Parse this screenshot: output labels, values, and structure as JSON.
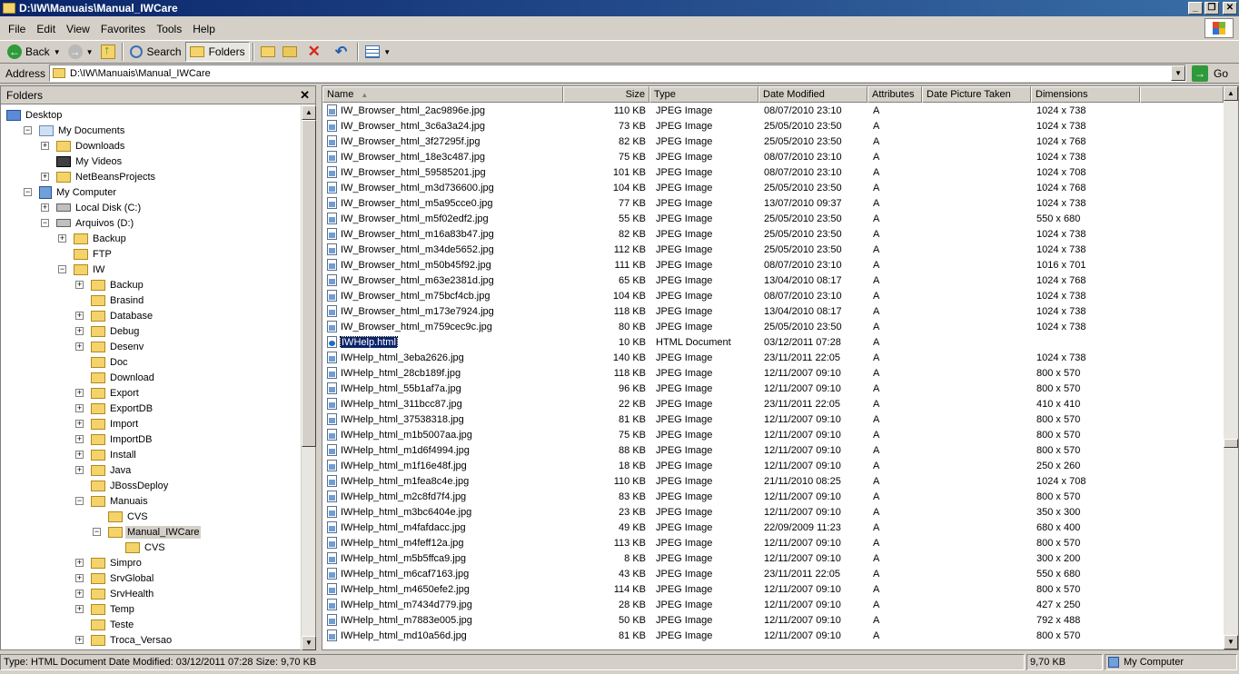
{
  "window": {
    "title": "D:\\IW\\Manuais\\Manual_IWCare",
    "min": "_",
    "restore": "❐",
    "close": "✕"
  },
  "menu": [
    {
      "label": "File"
    },
    {
      "label": "Edit"
    },
    {
      "label": "View"
    },
    {
      "label": "Favorites"
    },
    {
      "label": "Tools"
    },
    {
      "label": "Help"
    }
  ],
  "toolbar": {
    "back_label": "Back",
    "search_label": "Search",
    "folders_label": "Folders"
  },
  "address": {
    "label": "Address",
    "value": "D:\\IW\\Manuais\\Manual_IWCare",
    "go_label": "Go"
  },
  "folders": {
    "title": "Folders",
    "close": "✕",
    "tree": [
      {
        "label": "Desktop",
        "depth": 0,
        "exp": "",
        "icon": "desk"
      },
      {
        "label": "My Documents",
        "depth": 1,
        "exp": "−",
        "icon": "docs"
      },
      {
        "label": "Downloads",
        "depth": 2,
        "exp": "+",
        "icon": "folder"
      },
      {
        "label": "My Videos",
        "depth": 2,
        "exp": "",
        "icon": "vid"
      },
      {
        "label": "NetBeansProjects",
        "depth": 2,
        "exp": "+",
        "icon": "folder"
      },
      {
        "label": "My Computer",
        "depth": 1,
        "exp": "−",
        "icon": "comp"
      },
      {
        "label": "Local Disk (C:)",
        "depth": 2,
        "exp": "+",
        "icon": "disk"
      },
      {
        "label": "Arquivos (D:)",
        "depth": 2,
        "exp": "−",
        "icon": "disk"
      },
      {
        "label": "Backup",
        "depth": 3,
        "exp": "+",
        "icon": "folder"
      },
      {
        "label": "FTP",
        "depth": 3,
        "exp": "",
        "icon": "folder"
      },
      {
        "label": "IW",
        "depth": 3,
        "exp": "−",
        "icon": "folder"
      },
      {
        "label": "Backup",
        "depth": 4,
        "exp": "+",
        "icon": "folder"
      },
      {
        "label": "Brasind",
        "depth": 4,
        "exp": "",
        "icon": "folder"
      },
      {
        "label": "Database",
        "depth": 4,
        "exp": "+",
        "icon": "folder"
      },
      {
        "label": "Debug",
        "depth": 4,
        "exp": "+",
        "icon": "folder"
      },
      {
        "label": "Desenv",
        "depth": 4,
        "exp": "+",
        "icon": "folder"
      },
      {
        "label": "Doc",
        "depth": 4,
        "exp": "",
        "icon": "folder"
      },
      {
        "label": "Download",
        "depth": 4,
        "exp": "",
        "icon": "folder"
      },
      {
        "label": "Export",
        "depth": 4,
        "exp": "+",
        "icon": "folder"
      },
      {
        "label": "ExportDB",
        "depth": 4,
        "exp": "+",
        "icon": "folder"
      },
      {
        "label": "Import",
        "depth": 4,
        "exp": "+",
        "icon": "folder"
      },
      {
        "label": "ImportDB",
        "depth": 4,
        "exp": "+",
        "icon": "folder"
      },
      {
        "label": "Install",
        "depth": 4,
        "exp": "+",
        "icon": "folder"
      },
      {
        "label": "Java",
        "depth": 4,
        "exp": "+",
        "icon": "folder"
      },
      {
        "label": "JBossDeploy",
        "depth": 4,
        "exp": "",
        "icon": "folder"
      },
      {
        "label": "Manuais",
        "depth": 4,
        "exp": "−",
        "icon": "folder"
      },
      {
        "label": "CVS",
        "depth": 5,
        "exp": "",
        "icon": "folder"
      },
      {
        "label": "Manual_IWCare",
        "depth": 5,
        "exp": "−",
        "icon": "folder",
        "selected": true
      },
      {
        "label": "CVS",
        "depth": 6,
        "exp": "",
        "icon": "folder"
      },
      {
        "label": "Simpro",
        "depth": 4,
        "exp": "+",
        "icon": "folder"
      },
      {
        "label": "SrvGlobal",
        "depth": 4,
        "exp": "+",
        "icon": "folder"
      },
      {
        "label": "SrvHealth",
        "depth": 4,
        "exp": "+",
        "icon": "folder"
      },
      {
        "label": "Temp",
        "depth": 4,
        "exp": "+",
        "icon": "folder"
      },
      {
        "label": "Teste",
        "depth": 4,
        "exp": "",
        "icon": "folder"
      },
      {
        "label": "Troca_Versao",
        "depth": 4,
        "exp": "+",
        "icon": "folder"
      }
    ]
  },
  "columns": [
    "Name",
    "Size",
    "Type",
    "Date Modified",
    "Attributes",
    "Date Picture Taken",
    "Dimensions"
  ],
  "files": [
    {
      "name": "IW_Browser_html_2ac9896e.jpg",
      "size": "110 KB",
      "type": "JPEG Image",
      "date": "08/07/2010 23:10",
      "attr": "A",
      "dim": "1024 x 738"
    },
    {
      "name": "IW_Browser_html_3c6a3a24.jpg",
      "size": "73 KB",
      "type": "JPEG Image",
      "date": "25/05/2010 23:50",
      "attr": "A",
      "dim": "1024 x 738"
    },
    {
      "name": "IW_Browser_html_3f27295f.jpg",
      "size": "82 KB",
      "type": "JPEG Image",
      "date": "25/05/2010 23:50",
      "attr": "A",
      "dim": "1024 x 768"
    },
    {
      "name": "IW_Browser_html_18e3c487.jpg",
      "size": "75 KB",
      "type": "JPEG Image",
      "date": "08/07/2010 23:10",
      "attr": "A",
      "dim": "1024 x 738"
    },
    {
      "name": "IW_Browser_html_59585201.jpg",
      "size": "101 KB",
      "type": "JPEG Image",
      "date": "08/07/2010 23:10",
      "attr": "A",
      "dim": "1024 x 708"
    },
    {
      "name": "IW_Browser_html_m3d736600.jpg",
      "size": "104 KB",
      "type": "JPEG Image",
      "date": "25/05/2010 23:50",
      "attr": "A",
      "dim": "1024 x 768"
    },
    {
      "name": "IW_Browser_html_m5a95cce0.jpg",
      "size": "77 KB",
      "type": "JPEG Image",
      "date": "13/07/2010 09:37",
      "attr": "A",
      "dim": "1024 x 738"
    },
    {
      "name": "IW_Browser_html_m5f02edf2.jpg",
      "size": "55 KB",
      "type": "JPEG Image",
      "date": "25/05/2010 23:50",
      "attr": "A",
      "dim": "550 x 680"
    },
    {
      "name": "IW_Browser_html_m16a83b47.jpg",
      "size": "82 KB",
      "type": "JPEG Image",
      "date": "25/05/2010 23:50",
      "attr": "A",
      "dim": "1024 x 738"
    },
    {
      "name": "IW_Browser_html_m34de5652.jpg",
      "size": "112 KB",
      "type": "JPEG Image",
      "date": "25/05/2010 23:50",
      "attr": "A",
      "dim": "1024 x 738"
    },
    {
      "name": "IW_Browser_html_m50b45f92.jpg",
      "size": "111 KB",
      "type": "JPEG Image",
      "date": "08/07/2010 23:10",
      "attr": "A",
      "dim": "1016 x 701"
    },
    {
      "name": "IW_Browser_html_m63e2381d.jpg",
      "size": "65 KB",
      "type": "JPEG Image",
      "date": "13/04/2010 08:17",
      "attr": "A",
      "dim": "1024 x 768"
    },
    {
      "name": "IW_Browser_html_m75bcf4cb.jpg",
      "size": "104 KB",
      "type": "JPEG Image",
      "date": "08/07/2010 23:10",
      "attr": "A",
      "dim": "1024 x 738"
    },
    {
      "name": "IW_Browser_html_m173e7924.jpg",
      "size": "118 KB",
      "type": "JPEG Image",
      "date": "13/04/2010 08:17",
      "attr": "A",
      "dim": "1024 x 738"
    },
    {
      "name": "IW_Browser_html_m759cec9c.jpg",
      "size": "80 KB",
      "type": "JPEG Image",
      "date": "25/05/2010 23:50",
      "attr": "A",
      "dim": "1024 x 738"
    },
    {
      "name": "IWHelp.html",
      "size": "10 KB",
      "type": "HTML Document",
      "date": "03/12/2011 07:28",
      "attr": "A",
      "dim": "",
      "selected": true,
      "icon": "html"
    },
    {
      "name": "IWHelp_html_3eba2626.jpg",
      "size": "140 KB",
      "type": "JPEG Image",
      "date": "23/11/2011 22:05",
      "attr": "A",
      "dim": "1024 x 738"
    },
    {
      "name": "IWHelp_html_28cb189f.jpg",
      "size": "118 KB",
      "type": "JPEG Image",
      "date": "12/11/2007 09:10",
      "attr": "A",
      "dim": "800 x 570"
    },
    {
      "name": "IWHelp_html_55b1af7a.jpg",
      "size": "96 KB",
      "type": "JPEG Image",
      "date": "12/11/2007 09:10",
      "attr": "A",
      "dim": "800 x 570"
    },
    {
      "name": "IWHelp_html_311bcc87.jpg",
      "size": "22 KB",
      "type": "JPEG Image",
      "date": "23/11/2011 22:05",
      "attr": "A",
      "dim": "410 x 410"
    },
    {
      "name": "IWHelp_html_37538318.jpg",
      "size": "81 KB",
      "type": "JPEG Image",
      "date": "12/11/2007 09:10",
      "attr": "A",
      "dim": "800 x 570"
    },
    {
      "name": "IWHelp_html_m1b5007aa.jpg",
      "size": "75 KB",
      "type": "JPEG Image",
      "date": "12/11/2007 09:10",
      "attr": "A",
      "dim": "800 x 570"
    },
    {
      "name": "IWHelp_html_m1d6f4994.jpg",
      "size": "88 KB",
      "type": "JPEG Image",
      "date": "12/11/2007 09:10",
      "attr": "A",
      "dim": "800 x 570"
    },
    {
      "name": "IWHelp_html_m1f16e48f.jpg",
      "size": "18 KB",
      "type": "JPEG Image",
      "date": "12/11/2007 09:10",
      "attr": "A",
      "dim": "250 x 260"
    },
    {
      "name": "IWHelp_html_m1fea8c4e.jpg",
      "size": "110 KB",
      "type": "JPEG Image",
      "date": "21/11/2010 08:25",
      "attr": "A",
      "dim": "1024 x 708"
    },
    {
      "name": "IWHelp_html_m2c8fd7f4.jpg",
      "size": "83 KB",
      "type": "JPEG Image",
      "date": "12/11/2007 09:10",
      "attr": "A",
      "dim": "800 x 570"
    },
    {
      "name": "IWHelp_html_m3bc6404e.jpg",
      "size": "23 KB",
      "type": "JPEG Image",
      "date": "12/11/2007 09:10",
      "attr": "A",
      "dim": "350 x 300"
    },
    {
      "name": "IWHelp_html_m4fafdacc.jpg",
      "size": "49 KB",
      "type": "JPEG Image",
      "date": "22/09/2009 11:23",
      "attr": "A",
      "dim": "680 x 400"
    },
    {
      "name": "IWHelp_html_m4feff12a.jpg",
      "size": "113 KB",
      "type": "JPEG Image",
      "date": "12/11/2007 09:10",
      "attr": "A",
      "dim": "800 x 570"
    },
    {
      "name": "IWHelp_html_m5b5ffca9.jpg",
      "size": "8 KB",
      "type": "JPEG Image",
      "date": "12/11/2007 09:10",
      "attr": "A",
      "dim": "300 x 200"
    },
    {
      "name": "IWHelp_html_m6caf7163.jpg",
      "size": "43 KB",
      "type": "JPEG Image",
      "date": "23/11/2011 22:05",
      "attr": "A",
      "dim": "550 x 680"
    },
    {
      "name": "IWHelp_html_m4650efe2.jpg",
      "size": "114 KB",
      "type": "JPEG Image",
      "date": "12/11/2007 09:10",
      "attr": "A",
      "dim": "800 x 570"
    },
    {
      "name": "IWHelp_html_m7434d779.jpg",
      "size": "28 KB",
      "type": "JPEG Image",
      "date": "12/11/2007 09:10",
      "attr": "A",
      "dim": "427 x 250"
    },
    {
      "name": "IWHelp_html_m7883e005.jpg",
      "size": "50 KB",
      "type": "JPEG Image",
      "date": "12/11/2007 09:10",
      "attr": "A",
      "dim": "792 x 488"
    },
    {
      "name": "IWHelp_html_md10a56d.jpg",
      "size": "81 KB",
      "type": "JPEG Image",
      "date": "12/11/2007 09:10",
      "attr": "A",
      "dim": "800 x 570"
    }
  ],
  "status": {
    "info": "Type: HTML Document Date Modified: 03/12/2011 07:28 Size: 9,70 KB",
    "size": "9,70 KB",
    "zone": "My Computer"
  }
}
